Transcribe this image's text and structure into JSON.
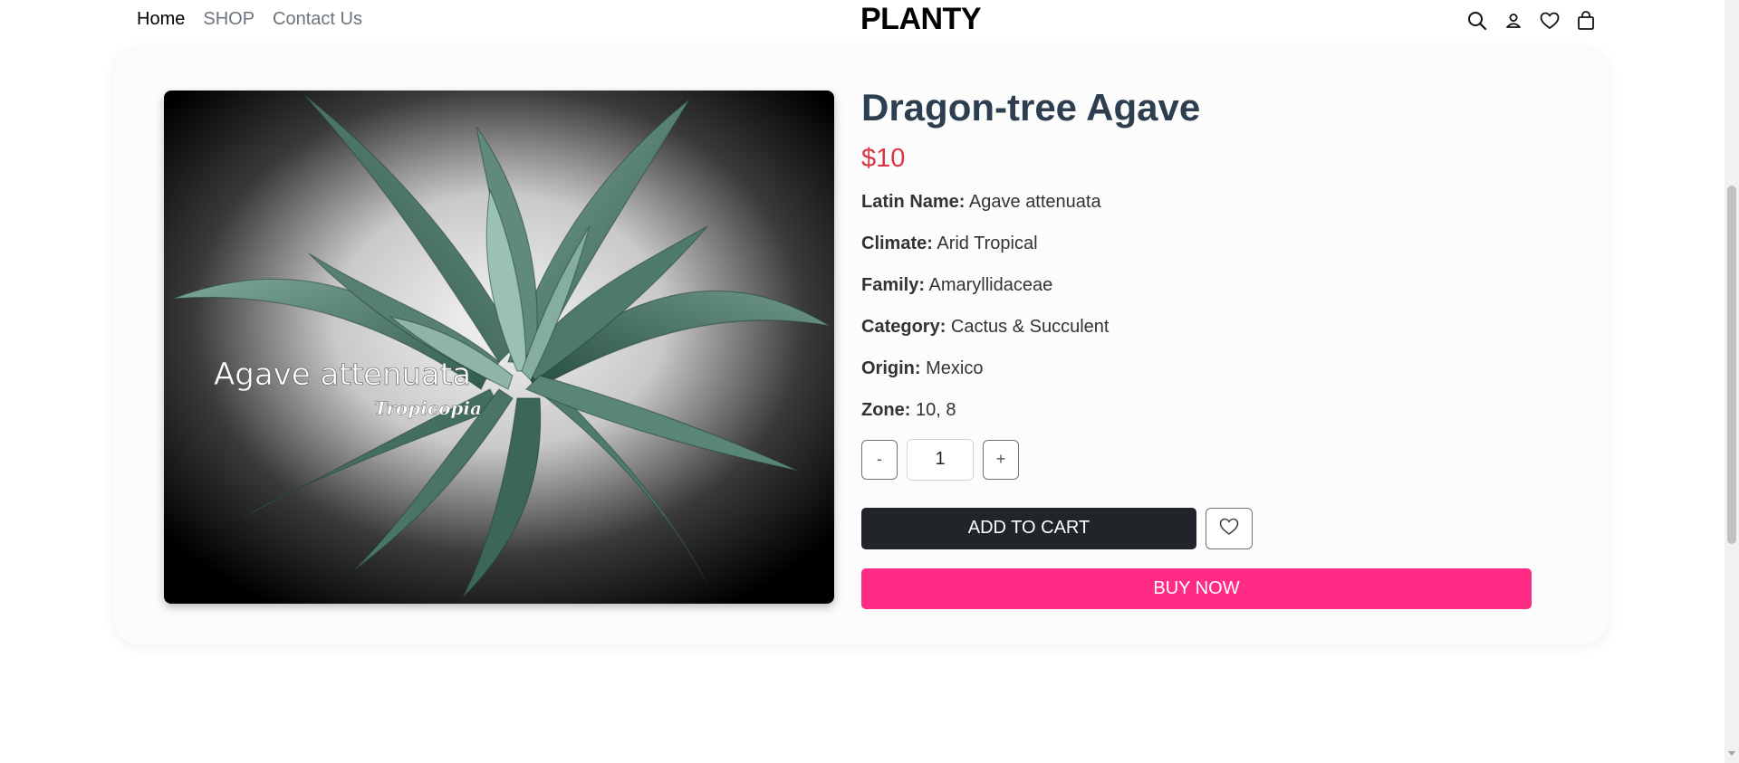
{
  "nav": {
    "links": [
      {
        "label": "Home",
        "active": true
      },
      {
        "label": "SHOP",
        "active": false
      },
      {
        "label": "Contact Us",
        "active": false
      }
    ],
    "brand": "PLANTY",
    "icons": [
      "search-icon",
      "user-icon",
      "heart-icon",
      "shopping-bag-icon"
    ]
  },
  "product": {
    "title": "Dragon-tree Agave",
    "price": "$10",
    "image": {
      "caption_main": "Agave attenuata",
      "caption_sub": "Tropicopia"
    },
    "attributes": [
      {
        "label": "Latin Name:",
        "value": "Agave attenuata"
      },
      {
        "label": "Climate:",
        "value": "Arid Tropical"
      },
      {
        "label": "Family:",
        "value": "Amaryllidaceae"
      },
      {
        "label": "Category:",
        "value": "Cactus & Succulent"
      },
      {
        "label": "Origin:",
        "value": "Mexico"
      },
      {
        "label": "Zone:",
        "value": "10, 8"
      }
    ],
    "quantity": {
      "minus_label": "-",
      "value": "1",
      "plus_label": "+"
    },
    "add_to_cart_label": "ADD TO CART",
    "buy_now_label": "BUY NOW"
  },
  "colors": {
    "title": "#2c3e50",
    "price": "#dc3545",
    "add_to_cart_bg": "#212529",
    "buy_now_bg": "#ff2b85"
  }
}
